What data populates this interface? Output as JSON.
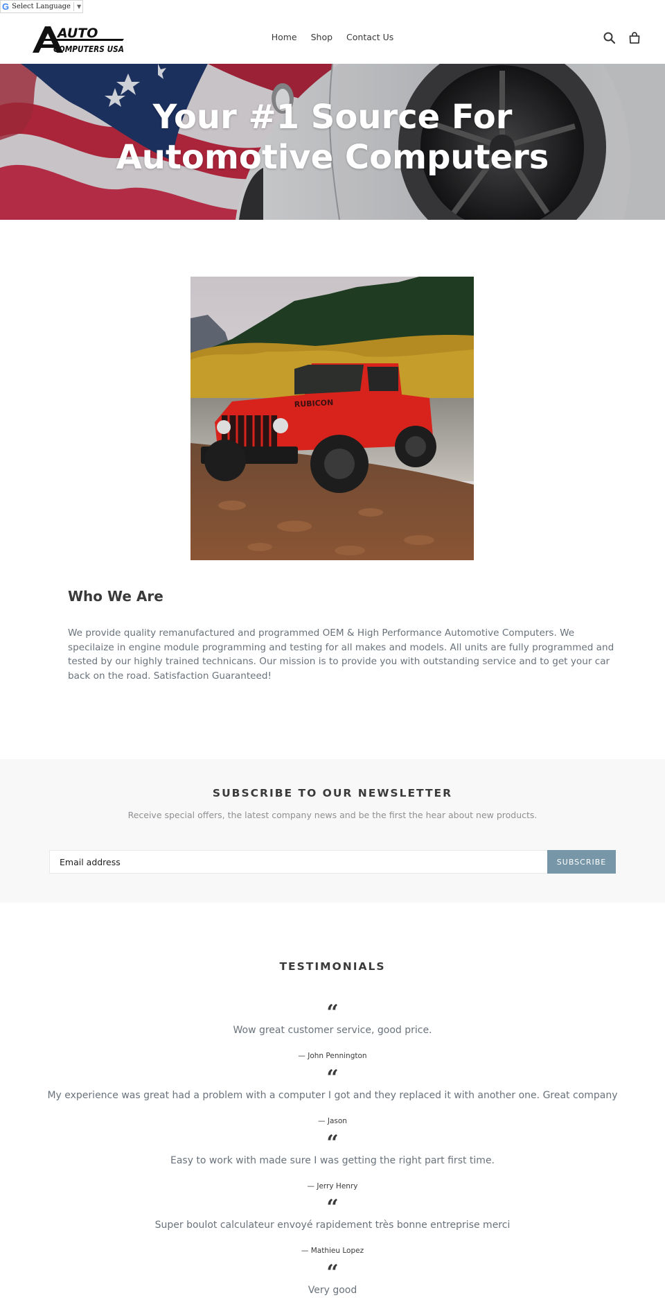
{
  "translate": {
    "label": "Select Language",
    "g": "G",
    "arrow": "▼"
  },
  "header": {
    "logo_alt": "Auto Computers USA",
    "logo_line1": "AUTO",
    "logo_line2": "COMPUTERS USA",
    "nav": [
      {
        "label": "Home"
      },
      {
        "label": "Shop"
      },
      {
        "label": "Contact Us"
      }
    ],
    "icons": {
      "search": "search-icon",
      "cart": "cart-icon"
    }
  },
  "hero": {
    "title_line1": "Your #1 Source For",
    "title_line2": "Automotive Computers"
  },
  "feature": {
    "alt": "Red Jeep Wrangler Rubicon crossing a river"
  },
  "about": {
    "title": "Who We Are",
    "text": "We provide quality remanufactured and programmed OEM & High Performance Automotive Computers. We specilaize in engine module programming and testing for all makes and models. All units are fully programmed and tested by our highly trained technicans. Our mission is to provide you with outstanding service and to get your car back on the road. Satisfaction Guaranteed!"
  },
  "newsletter": {
    "title": "SUBSCRIBE TO OUR NEWSLETTER",
    "subtitle": "Receive special offers, the latest company news and be the first the hear about new products.",
    "email_placeholder": "Email address",
    "email_value": "",
    "button": "SUBSCRIBE",
    "button_color": "#7796a8"
  },
  "testimonials": {
    "title": "TESTIMONIALS",
    "quote_mark": "“",
    "items": [
      {
        "text": "Wow great customer service, good price.",
        "author": "— John Pennington"
      },
      {
        "text": "My experience was great had a problem with a computer I got and they replaced it with another one. Great company",
        "author": "— Jason"
      },
      {
        "text": "Easy to work with made sure I was getting the right part first time.",
        "author": "— Jerry Henry"
      },
      {
        "text": "Super boulot calculateur envoyé rapidement très bonne entreprise merci",
        "author": "— Mathieu Lopez"
      },
      {
        "text": "Very good",
        "author": ""
      }
    ]
  }
}
